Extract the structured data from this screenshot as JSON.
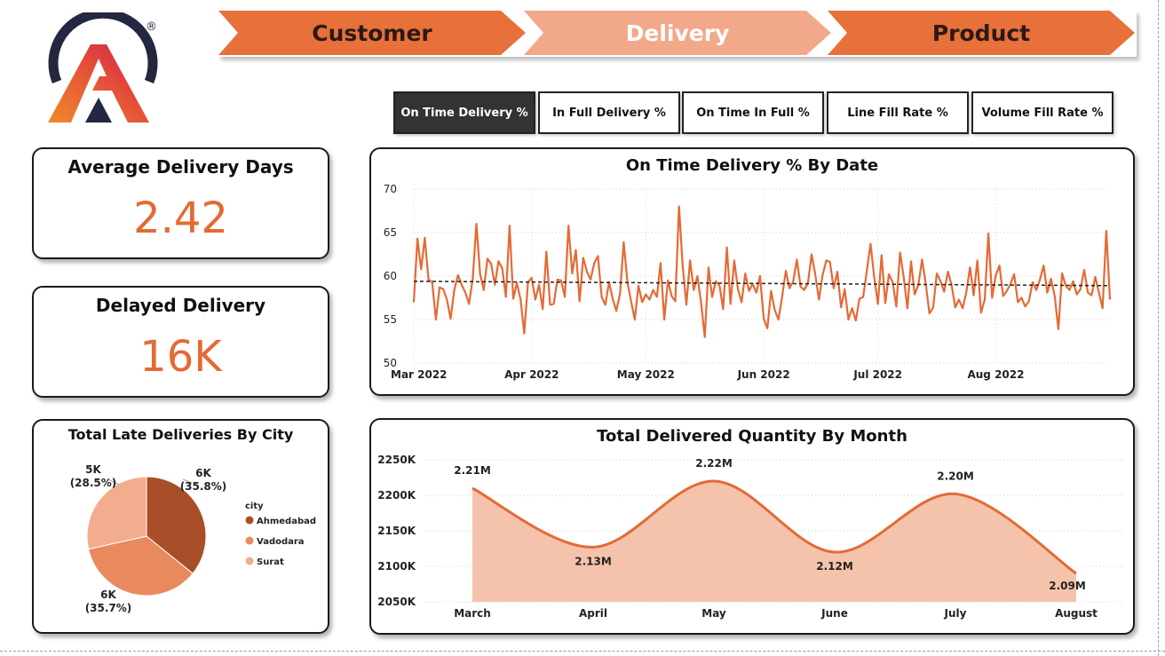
{
  "nav": {
    "tabs": [
      {
        "label": "Customer"
      },
      {
        "label": "Delivery"
      },
      {
        "label": "Product"
      }
    ]
  },
  "metric_buttons": [
    {
      "label": "On Time Delivery %",
      "active": true
    },
    {
      "label": "In Full Delivery %",
      "active": false
    },
    {
      "label": "On Time In Full %",
      "active": false
    },
    {
      "label": "Line Fill Rate %",
      "active": false
    },
    {
      "label": "Volume Fill Rate %",
      "active": false
    }
  ],
  "kpis": {
    "avg_delivery_days": {
      "title": "Average Delivery Days",
      "value": "2.42"
    },
    "delayed_delivery": {
      "title": "Delayed Delivery",
      "value": "16K"
    }
  },
  "colors": {
    "accent": "#e46a35",
    "ahmedabad": "#a84f2a",
    "vadodara": "#e98a5e",
    "surat": "#f2ad8e",
    "area_fill": "#f5c3ab",
    "active_button": "#333333"
  },
  "logo": {
    "registered_mark": "®"
  },
  "chart_data": [
    {
      "type": "line",
      "title": "On Time Delivery % By Date",
      "ylim": [
        50,
        70
      ],
      "yticks": [
        "70",
        "65",
        "60",
        "55",
        "50"
      ],
      "x_tick_labels": [
        "Mar 2022",
        "Apr 2022",
        "May 2022",
        "Jun 2022",
        "Jul 2022",
        "Aug 2022"
      ],
      "x_start": "2022-03-01",
      "x_end": "2022-08-31",
      "trend_line": {
        "start": 59.4,
        "end": 58.9,
        "style": "dashed"
      },
      "series": [
        {
          "values": [
            57.0,
            64.3,
            60.8,
            64.4,
            59.6,
            59.3,
            55.0,
            58.7,
            58.5,
            57.3,
            55.1,
            58.4,
            60.1,
            59.0,
            58.1,
            56.8,
            59.7,
            66.0,
            60.2,
            58.4,
            62.0,
            61.4,
            59.0,
            61.7,
            60.9,
            57.6,
            65.8,
            57.4,
            59.2,
            57.3,
            53.4,
            59.3,
            59.8,
            57.3,
            59.0,
            56.2,
            62.8,
            56.7,
            56.8,
            59.6,
            59.5,
            57.6,
            65.8,
            60.3,
            63.0,
            57.1,
            62.1,
            60.5,
            59.6,
            61.5,
            62.3,
            57.6,
            56.7,
            59.3,
            57.4,
            56.0,
            58.0,
            63.9,
            59.3,
            57.1,
            55.0,
            58.9,
            57.0,
            57.9,
            57.3,
            58.4,
            57.6,
            61.5,
            55.0,
            59.5,
            57.7,
            57.1,
            68.0,
            61.2,
            56.7,
            61.8,
            58.4,
            60.0,
            56.9,
            53.0,
            61.0,
            57.6,
            59.4,
            58.9,
            56.2,
            63.3,
            56.8,
            61.8,
            58.5,
            57.0,
            60.3,
            58.3,
            59.1,
            58.1,
            60.0,
            55.1,
            54.0,
            58.3,
            56.1,
            55.0,
            57.6,
            60.6,
            58.6,
            59.4,
            61.9,
            58.8,
            58.4,
            59.2,
            62.5,
            60.2,
            57.3,
            60.1,
            61.8,
            61.6,
            58.6,
            60.5,
            56.4,
            58.5,
            55.0,
            56.3,
            54.9,
            57.4,
            57.6,
            60.6,
            63.7,
            59.9,
            56.8,
            62.4,
            56.9,
            60.2,
            59.3,
            56.5,
            62.7,
            59.9,
            56.3,
            61.7,
            57.9,
            59.0,
            61.9,
            59.1,
            55.7,
            56.4,
            60.3,
            59.4,
            58.2,
            60.5,
            59.0,
            56.4,
            57.3,
            56.3,
            58.1,
            61.0,
            57.8,
            61.8,
            55.8,
            57.3,
            64.9,
            57.5,
            60.1,
            61.2,
            57.7,
            58.3,
            59.1,
            60.2,
            57.0,
            57.5,
            56.5,
            57.1,
            59.3,
            58.4,
            59.6,
            61.2,
            58.1,
            59.7,
            57.7,
            53.9,
            60.3,
            58.9,
            58.4,
            59.4,
            57.9,
            58.5,
            60.7,
            58.1,
            57.8,
            59.9,
            58.1,
            56.3,
            65.2,
            57.3
          ]
        }
      ]
    },
    {
      "type": "pie",
      "title": "Total Late Deliveries By City",
      "legend_title": "city",
      "legend_placement": "right",
      "slices": [
        {
          "name": "Ahmedabad",
          "value": 35.8,
          "label": "6K",
          "pct_label": "(35.8%)"
        },
        {
          "name": "Vadodara",
          "value": 35.7,
          "label": "6K",
          "pct_label": "(35.7%)"
        },
        {
          "name": "Surat",
          "value": 28.5,
          "label": "5K",
          "pct_label": "(28.5%)"
        }
      ]
    },
    {
      "type": "area",
      "title": "Total Delivered Quantity By Month",
      "categories": [
        "March",
        "April",
        "May",
        "June",
        "July",
        "August"
      ],
      "values": [
        2210,
        2127,
        2220,
        2120,
        2202,
        2090
      ],
      "data_labels": [
        "2.21M",
        "2.13M",
        "2.22M",
        "2.12M",
        "2.20M",
        "2.09M"
      ],
      "ylim": [
        2050,
        2250
      ],
      "yticks": [
        "2250K",
        "2200K",
        "2150K",
        "2100K",
        "2050K"
      ]
    }
  ]
}
